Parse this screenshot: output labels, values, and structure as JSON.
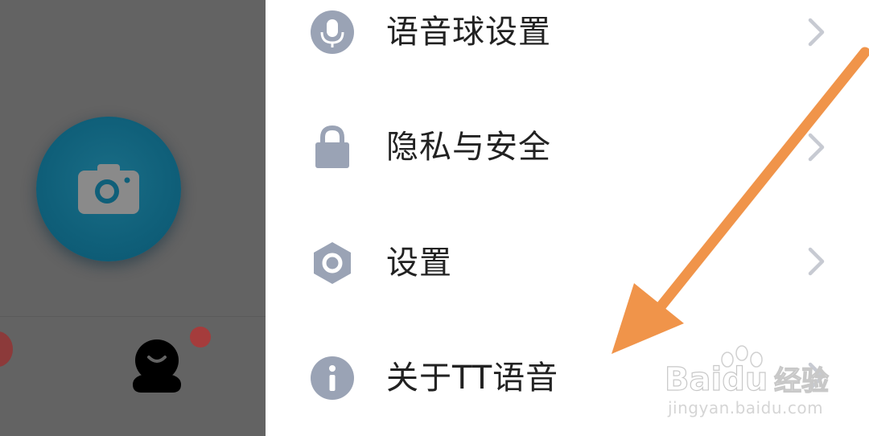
{
  "settings": {
    "items": [
      {
        "label": "语音球设置",
        "icon": "microphone-icon"
      },
      {
        "label": "隐私与安全",
        "icon": "lock-icon"
      },
      {
        "label": "设置",
        "icon": "hexagon-gear-icon"
      },
      {
        "label": "关于TT语音",
        "icon": "info-icon"
      }
    ]
  },
  "background_app": {
    "camera_button_icon": "camera-icon",
    "profile_tab_icon": "avatar-icon"
  },
  "watermark": {
    "brand": "Baidu",
    "cn": "经验",
    "url": "jingyan.baidu.com"
  },
  "colors": {
    "overlay": "#636363",
    "fab": "#0f5f79",
    "icon_gray": "#9aa3b5",
    "chevron": "#c7cad2",
    "arrow": "#f0944a",
    "badge_red": "#a53c3c"
  }
}
